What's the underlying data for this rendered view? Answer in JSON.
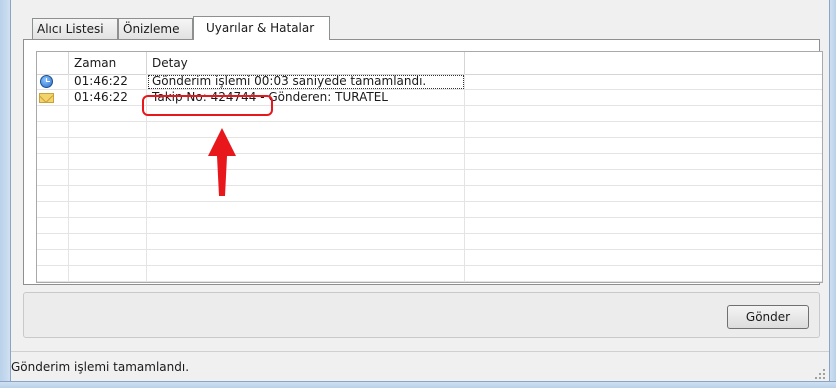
{
  "tabs": [
    {
      "label": "Alıcı Listesi",
      "active": false
    },
    {
      "label": "Önizleme",
      "active": false
    },
    {
      "label": "Uyarılar & Hatalar",
      "active": true
    }
  ],
  "grid": {
    "columns": [
      "",
      "Zaman",
      "Detay",
      ""
    ],
    "rows": [
      {
        "icon": "clock-icon",
        "time": "01:46:22",
        "detail": "Gönderim işlemi 00:03 saniyede tamamlandı."
      },
      {
        "icon": "mail-icon",
        "time": "01:46:22",
        "detail": "Takip No: 424744 - Gönderen: TURATEL"
      }
    ]
  },
  "annotation": {
    "color": "#e8171c"
  },
  "buttons": {
    "send": "Gönder"
  },
  "status": {
    "text": "Gönderim işlemi tamamlandı."
  }
}
